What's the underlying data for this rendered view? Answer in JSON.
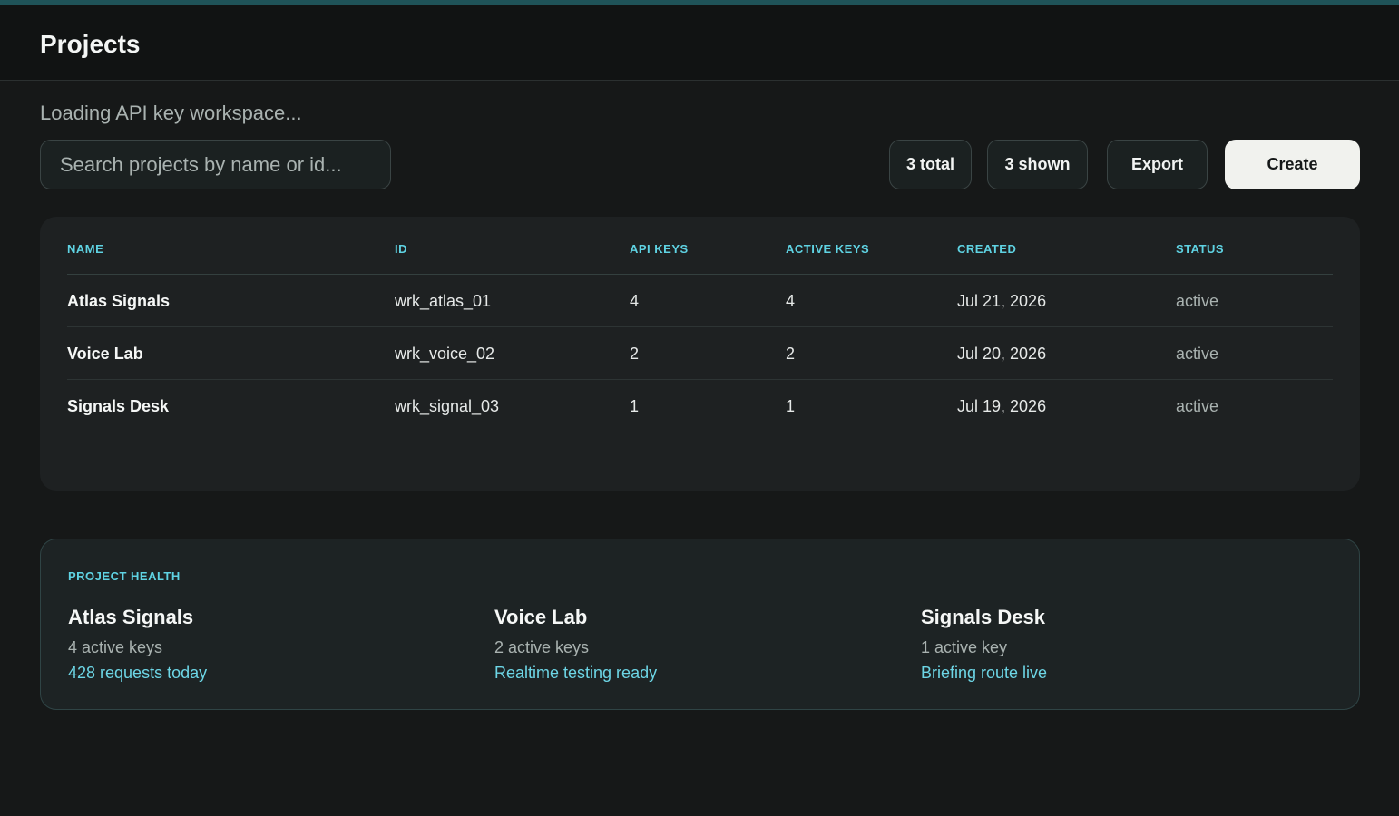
{
  "header": {
    "title": "Projects"
  },
  "status_text": "Loading API key workspace...",
  "search": {
    "placeholder": "Search projects by name or id...",
    "value": ""
  },
  "toolbar": {
    "total_label": "3 total",
    "shown_label": "3 shown",
    "export_label": "Export",
    "create_label": "Create"
  },
  "table": {
    "columns": [
      "NAME",
      "ID",
      "API KEYS",
      "ACTIVE KEYS",
      "CREATED",
      "STATUS"
    ],
    "rows": [
      [
        "Atlas Signals",
        "wrk_atlas_01",
        "4",
        "4",
        "Jul 21, 2026",
        "active"
      ],
      [
        "Voice Lab",
        "wrk_voice_02",
        "2",
        "2",
        "Jul 20, 2026",
        "active"
      ],
      [
        "Signals Desk",
        "wrk_signal_03",
        "1",
        "1",
        "Jul 19, 2026",
        "active"
      ]
    ]
  },
  "health": {
    "title": "PROJECT HEALTH",
    "items": [
      {
        "name": "Atlas Signals",
        "keys": "4 active keys",
        "note": "428 requests today"
      },
      {
        "name": "Voice Lab",
        "keys": "2 active keys",
        "note": "Realtime testing ready"
      },
      {
        "name": "Signals Desk",
        "keys": "1 active key",
        "note": "Briefing route live"
      }
    ]
  },
  "colors": {
    "background": "#161818",
    "accent": "#5fd3e3",
    "top_bar": "#1f5358",
    "create_button": "#f1f2ee"
  }
}
